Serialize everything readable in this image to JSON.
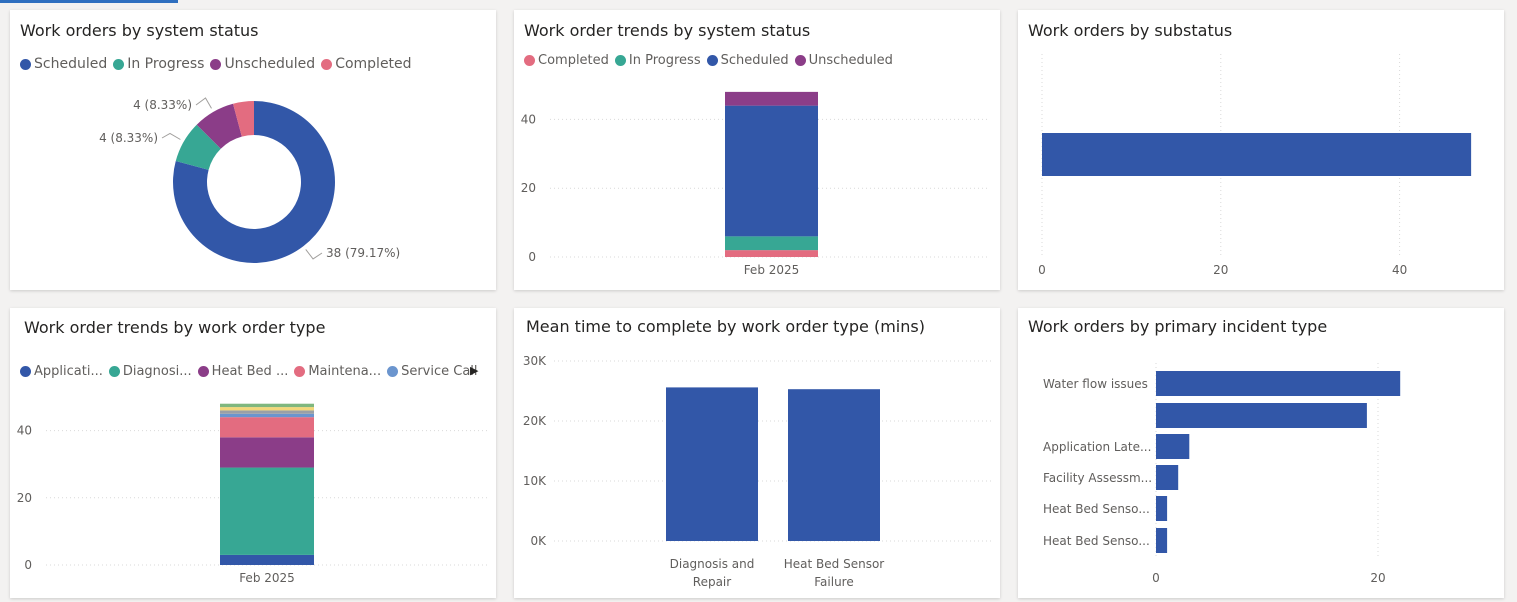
{
  "colors": {
    "blue": "#3257a8",
    "teal": "#37a794",
    "purple": "#8b3d88",
    "pink": "#e36c80",
    "lightblue": "#6b95ce",
    "yellow": "#f2d77a",
    "grid": "#d9d9d9"
  },
  "cards": {
    "status_donut": {
      "title": "Work orders by system status",
      "legend": [
        {
          "label": "Scheduled",
          "color": "#3257a8"
        },
        {
          "label": "In Progress",
          "color": "#37a794"
        },
        {
          "label": "Unscheduled",
          "color": "#8b3d88"
        },
        {
          "label": "Completed",
          "color": "#e36c80"
        }
      ]
    },
    "status_trend": {
      "title": "Work order trends by system status",
      "legend": [
        {
          "label": "Completed",
          "color": "#e36c80"
        },
        {
          "label": "In Progress",
          "color": "#37a794"
        },
        {
          "label": "Scheduled",
          "color": "#3257a8"
        },
        {
          "label": "Unscheduled",
          "color": "#8b3d88"
        }
      ]
    },
    "substatus": {
      "title": "Work orders by substatus"
    },
    "type_trend": {
      "title": "Work order trends by work order type",
      "legend": [
        {
          "label": "Applicati...",
          "color": "#3257a8"
        },
        {
          "label": "Diagnosi...",
          "color": "#37a794"
        },
        {
          "label": "Heat Bed ...",
          "color": "#8b3d88"
        },
        {
          "label": "Maintena...",
          "color": "#e36c80"
        },
        {
          "label": "Service Call",
          "color": "#6b95ce"
        }
      ]
    },
    "mean_time": {
      "title": "Mean time to complete by work order type (mins)"
    },
    "incident": {
      "title": "Work orders by primary incident type"
    }
  },
  "chart_data": [
    {
      "type": "pie",
      "title": "Work orders by system status",
      "categories": [
        "Scheduled",
        "In Progress",
        "Unscheduled",
        "Completed"
      ],
      "values": [
        38,
        4,
        4,
        2
      ],
      "data_labels": [
        "38 (79.17%)",
        "4 (8.33%)",
        "4 (8.33%)",
        ""
      ]
    },
    {
      "type": "bar",
      "title": "Work order trends by system status",
      "categories": [
        "Feb 2025"
      ],
      "series": [
        {
          "name": "Completed",
          "values": [
            2
          ]
        },
        {
          "name": "In Progress",
          "values": [
            4
          ]
        },
        {
          "name": "Scheduled",
          "values": [
            38
          ]
        },
        {
          "name": "Unscheduled",
          "values": [
            4
          ]
        }
      ],
      "yticks": [
        "0",
        "20",
        "40"
      ],
      "ylim": [
        0,
        50
      ]
    },
    {
      "type": "bar",
      "title": "Work orders by substatus",
      "categories": [
        ""
      ],
      "values": [
        48
      ],
      "xticks": [
        "0",
        "20",
        "40"
      ],
      "xlim": [
        0,
        48
      ]
    },
    {
      "type": "bar",
      "title": "Work order trends by work order type",
      "categories": [
        "Feb 2025"
      ],
      "series": [
        {
          "name": "Application",
          "values": [
            3
          ]
        },
        {
          "name": "Diagnosis",
          "values": [
            26
          ]
        },
        {
          "name": "Heat Bed",
          "values": [
            9
          ]
        },
        {
          "name": "Maintenance",
          "values": [
            6
          ]
        },
        {
          "name": "Service Call",
          "values": [
            1
          ]
        },
        {
          "name": "",
          "values": [
            1
          ]
        },
        {
          "name": "",
          "values": [
            1
          ]
        },
        {
          "name": "",
          "values": [
            1
          ]
        }
      ],
      "yticks": [
        "0",
        "20",
        "40"
      ],
      "ylim": [
        0,
        53
      ]
    },
    {
      "type": "bar",
      "title": "Mean time to complete by work order type (mins)",
      "categories": [
        "Diagnosis and Repair",
        "Heat Bed Sensor Failure"
      ],
      "category_lines": [
        [
          "Diagnosis and",
          "Repair"
        ],
        [
          "Heat Bed Sensor",
          "Failure"
        ]
      ],
      "values": [
        25600,
        25300
      ],
      "yticks": [
        "0K",
        "10K",
        "20K",
        "30K"
      ],
      "ylim": [
        0,
        33000
      ]
    },
    {
      "type": "bar",
      "title": "Work orders by primary incident type",
      "categories": [
        "Water flow issues",
        "",
        "Application Late...",
        "Facility Assessm...",
        "Heat Bed Senso...",
        "Heat Bed Senso..."
      ],
      "values": [
        22,
        19,
        3,
        2,
        1,
        1
      ],
      "xticks": [
        "0",
        "20"
      ],
      "xlim": [
        0,
        30
      ]
    }
  ]
}
